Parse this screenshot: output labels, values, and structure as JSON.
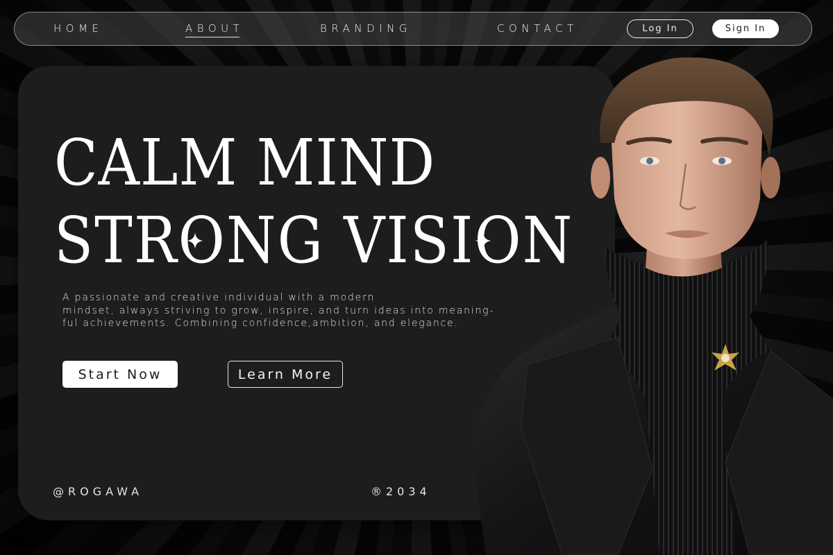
{
  "nav": {
    "links": [
      {
        "label": "HOME",
        "active": false
      },
      {
        "label": "ABOUT",
        "active": true
      },
      {
        "label": "BRANDING",
        "active": false
      },
      {
        "label": "CONTACT",
        "active": false
      }
    ],
    "login_label": "Log In",
    "signin_label": "Sign In"
  },
  "hero": {
    "headline_line1": "CALM MIND",
    "headline_line2": "STRONG VISION",
    "description_lines": [
      "A passionate and creative individual with a modern",
      "mindset, always striving to grow, inspire, and turn ideas into meaning-",
      "ful achievements. Combining confidence,ambition, and elegance."
    ],
    "primary_cta": "Start Now",
    "secondary_cta": "Learn More"
  },
  "footer": {
    "handle": "@ROGAWA",
    "copyright": "®2034"
  },
  "image": {
    "portrait_icon": "man-in-black-suit-portrait-image"
  },
  "colors": {
    "background": "#151517",
    "card": "#1d1d1e",
    "text": "#ffffff",
    "primary_button_bg": "#ffffff",
    "primary_button_text": "#1a1a1a"
  }
}
